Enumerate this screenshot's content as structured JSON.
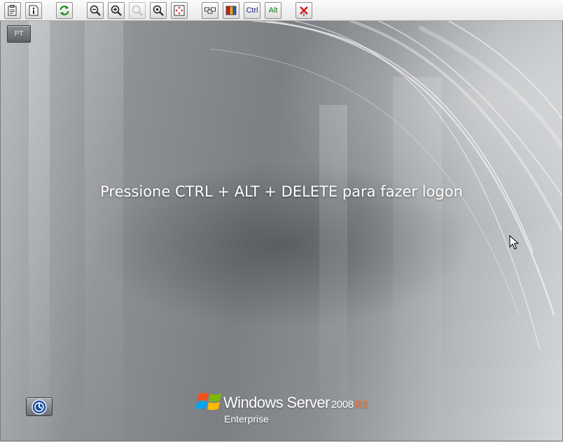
{
  "toolbar": {
    "buttons": [
      {
        "id": "properties",
        "icon": "properties-icon"
      },
      {
        "id": "info",
        "icon": "info-icon"
      },
      {
        "id": "refresh",
        "icon": "refresh-icon"
      },
      {
        "id": "zoom-out",
        "icon": "zoom-out-icon"
      },
      {
        "id": "zoom-in",
        "icon": "zoom-in-icon"
      },
      {
        "id": "zoom-reset",
        "icon": "zoom-reset-icon",
        "disabled": true
      },
      {
        "id": "zoom-custom",
        "icon": "zoom-custom-icon"
      },
      {
        "id": "fit-screen",
        "icon": "fit-screen-icon"
      },
      {
        "id": "ctrl-alt-del",
        "icon": "ctrl-alt-del-icon"
      },
      {
        "id": "screen-options",
        "icon": "screen-options-icon"
      },
      {
        "id": "ctrl",
        "label": "Ctrl"
      },
      {
        "id": "alt",
        "label": "Alt"
      },
      {
        "id": "disconnect",
        "icon": "disconnect-icon"
      }
    ],
    "ctrl_label": "Ctrl",
    "alt_label": "Alt"
  },
  "desktop": {
    "language_indicator": "PT",
    "logon_prompt": "Pressione CTRL + ALT + DELETE para fazer logon",
    "ease_of_access_icon": "ease-of-access-icon",
    "branding": {
      "product": "Windows Server",
      "version": "2008",
      "release": "R2",
      "edition": "Enterprise"
    }
  },
  "colors": {
    "ctrl_text": "#1a1a8c",
    "alt_text": "#0d7a0d",
    "disconnect_red": "#d11b1b",
    "release_orange": "#ff7a30"
  }
}
